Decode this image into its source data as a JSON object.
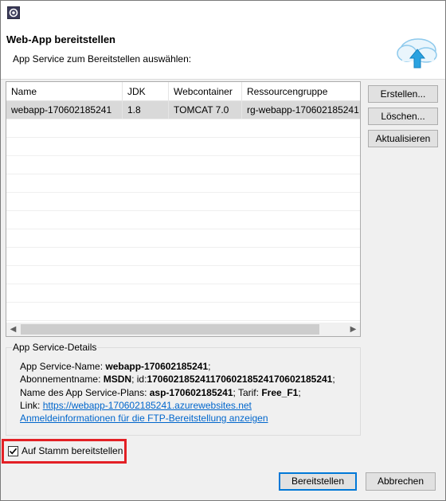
{
  "banner": {
    "title": "Web-App bereitstellen",
    "subtitle": "App Service zum Bereitstellen auswählen:"
  },
  "table": {
    "columns": [
      "Name",
      "JDK",
      "Webcontainer",
      "Ressourcengruppe"
    ],
    "rows": [
      [
        "webapp-170602185241",
        "1.8",
        "TOMCAT 7.0",
        "rg-webapp-170602185241"
      ]
    ]
  },
  "side_buttons": {
    "create": "Erstellen...",
    "delete": "Löschen...",
    "refresh": "Aktualisieren"
  },
  "details": {
    "group_label": "App Service-Details",
    "app_name_label": "App Service-Name: ",
    "app_name_value": "webapp-170602185241",
    "app_name_suffix": ";",
    "subscription_label": "Abonnementname: ",
    "subscription_value": "MSDN",
    "subscription_mid": "; id:",
    "subscription_id": "17060218524117060218524170602185241",
    "subscription_suffix": ";",
    "plan_label": "Name des App Service-Plans: ",
    "plan_value": "asp-170602185241",
    "plan_mid": "; Tarif: ",
    "tier_value": "Free_F1",
    "tier_suffix": ";",
    "link_label": "Link: ",
    "link_url": "https://webapp-170602185241.azurewebsites.net",
    "ftp_link": "Anmeldeinformationen für die FTP-Bereitstellung anzeigen"
  },
  "deploy_to_root": {
    "label": "Auf Stamm bereitstellen",
    "checked": true
  },
  "footer": {
    "deploy": "Bereitstellen",
    "cancel": "Abbrechen"
  },
  "colors": {
    "highlight_box": "#e32025",
    "link": "#0066cc",
    "selected_row": "#d9d9d9",
    "default_button_border": "#0078d7"
  }
}
